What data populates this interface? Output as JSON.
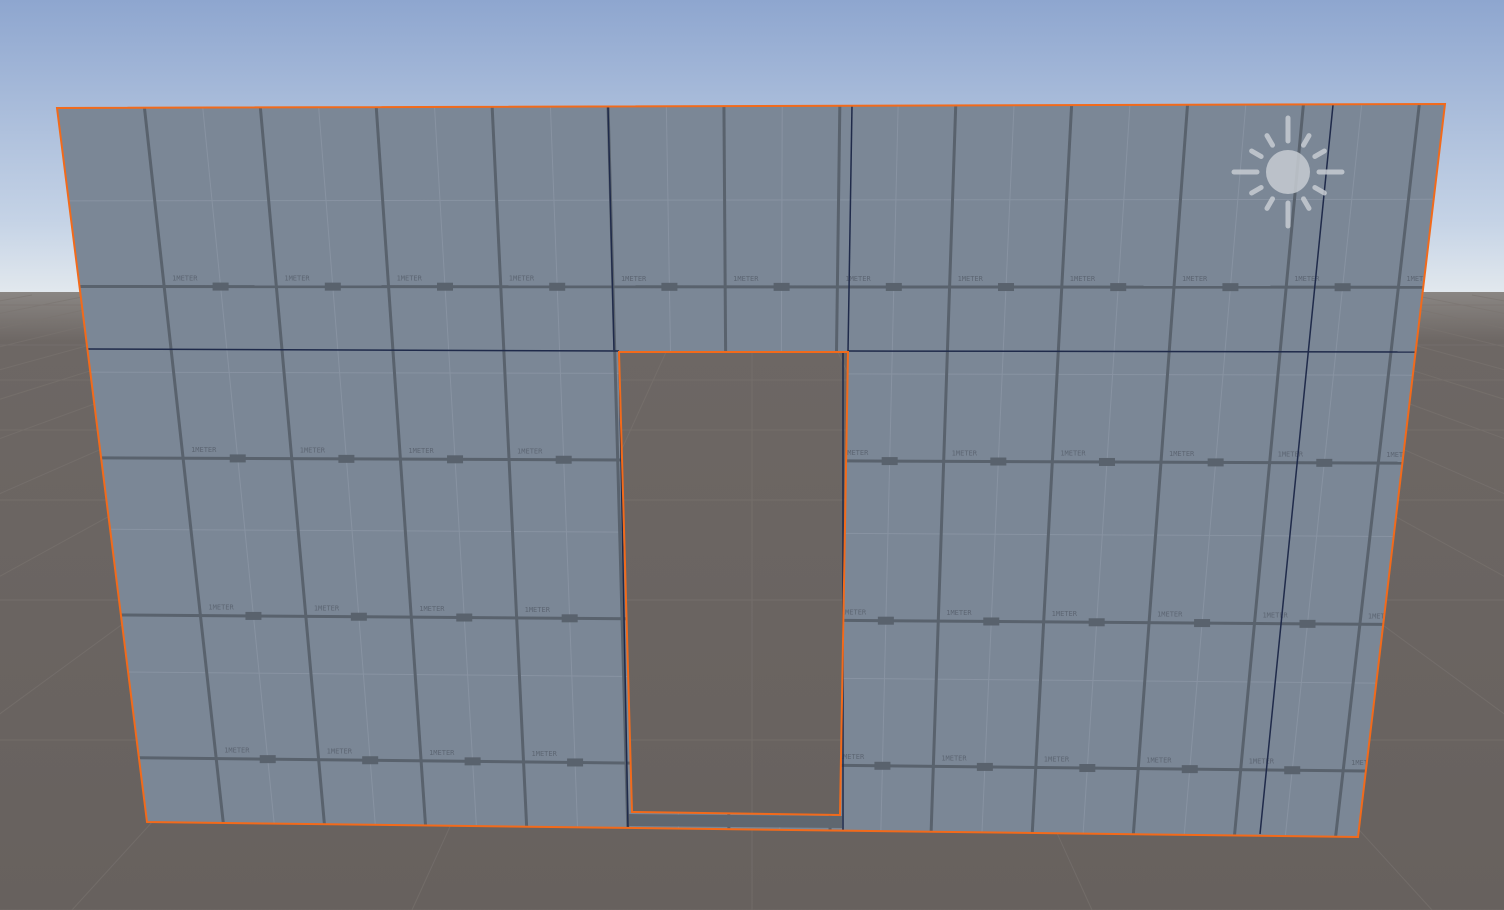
{
  "scene": {
    "view": "scene-view",
    "object": "wall-with-door-opening",
    "texture_label": "1METER",
    "colors": {
      "sky_top": "#8ea6cf",
      "sky_horizon": "#dfe7ee",
      "ground": "#6a6461",
      "wall": "#7b8796",
      "selection_outline": "#f26a1b",
      "edge": "#1f2a4a"
    },
    "icons": [
      "directional-light-icon"
    ]
  }
}
